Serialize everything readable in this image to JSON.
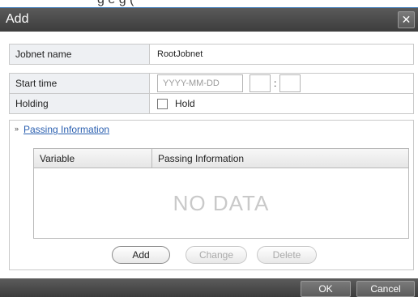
{
  "dialog": {
    "title": "Add",
    "close_symbol": "✕",
    "background_partial_text": "g e     g      ("
  },
  "form": {
    "jobnet_name_label": "Jobnet name",
    "jobnet_name_value": "RootJobnet",
    "start_time_label": "Start time",
    "date_placeholder": "YYYY-MM-DD",
    "hour_value": "",
    "minute_value": "",
    "time_separator": ":",
    "holding_label": "Holding",
    "hold_checkbox_label": "Hold",
    "hold_checked": false
  },
  "passing_section": {
    "expand_symbol": "»",
    "title": "Passing Information",
    "columns": [
      "Variable",
      "Passing Information"
    ],
    "rows": [],
    "empty_text": "NO DATA",
    "buttons": {
      "add": "Add",
      "change": "Change",
      "delete": "Delete"
    }
  },
  "footer": {
    "ok": "OK",
    "cancel": "Cancel"
  },
  "colors": {
    "titlebar": "#4a4a4a",
    "link": "#2a5fb0",
    "label_bg": "#eef0f3"
  }
}
